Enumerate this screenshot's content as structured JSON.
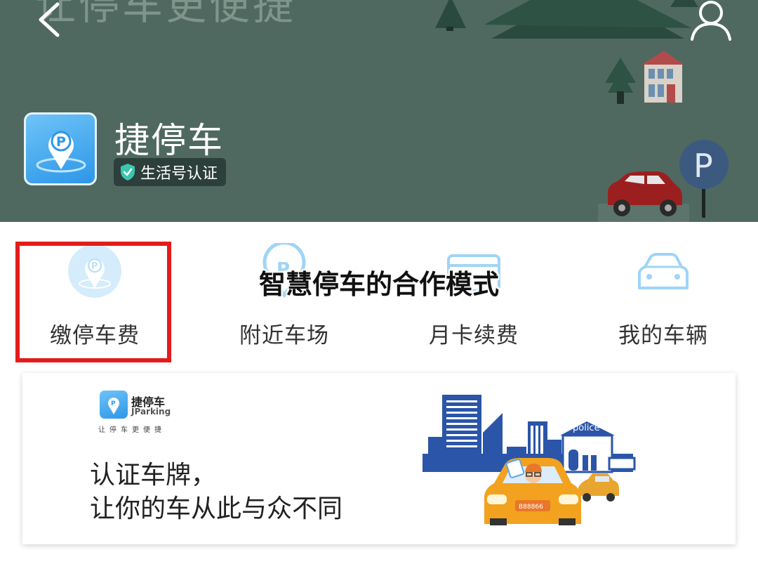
{
  "header": {
    "slogan": "让停车更便捷",
    "back_icon": "chevron-left-icon",
    "user_icon": "user-icon",
    "app_name": "捷停车",
    "verify_badge": "生活号认证",
    "colors": {
      "background": "#4f6961",
      "badge": "#2d3f3b",
      "accent": "#2c97e8"
    }
  },
  "menu": {
    "items": [
      {
        "label": "缴停车费",
        "icon": "parking-pin-icon"
      },
      {
        "label": "附近车场",
        "icon": "nearby-parking-icon"
      },
      {
        "label": "月卡续费",
        "icon": "card-icon"
      },
      {
        "label": "我的车辆",
        "icon": "car-icon"
      }
    ],
    "highlight_color": "#e41b1b"
  },
  "watermark": "智慧停车的合作模式",
  "banner": {
    "brand": "捷停车",
    "brand_en": "JParking",
    "tagline": "让停车更便捷",
    "line1": "认证车牌，",
    "line2": "让你的车从此与众不同",
    "building_sign": "police",
    "plate": "B88866"
  }
}
